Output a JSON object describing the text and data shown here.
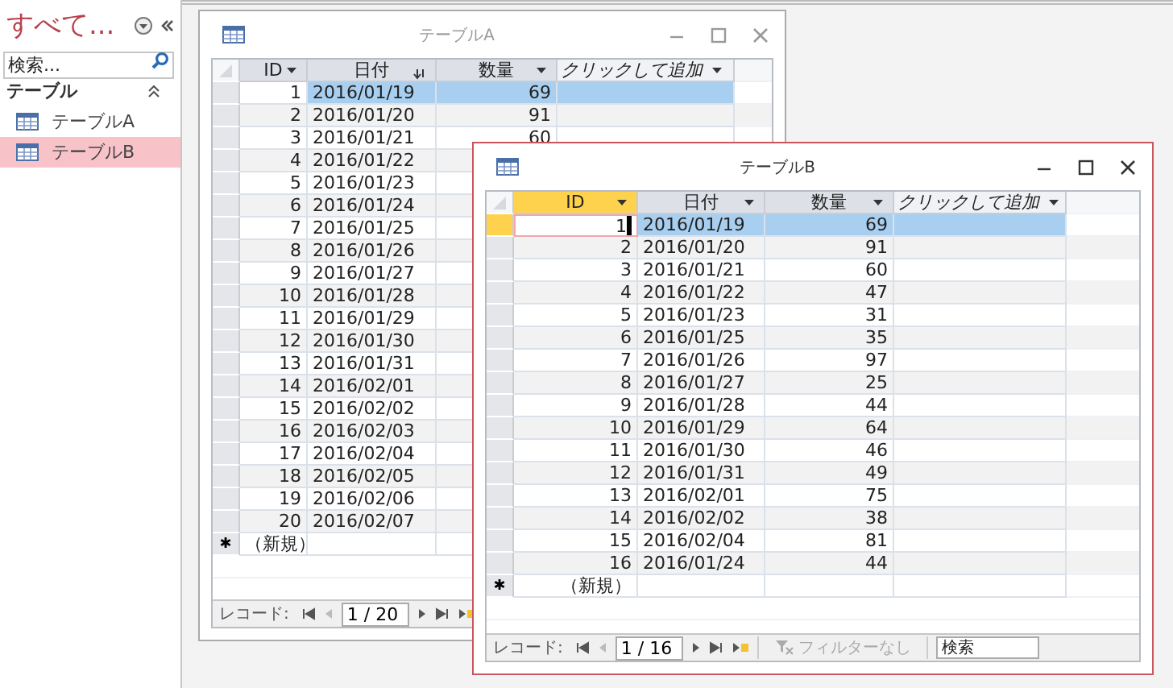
{
  "sidebar": {
    "title": "すべて...",
    "search": {
      "placeholder": "検索..."
    },
    "groups": [
      {
        "label": "テーブル",
        "expanded": true,
        "items": [
          {
            "label": "テーブルA",
            "selected": false
          },
          {
            "label": "テーブルB",
            "selected": true
          }
        ]
      }
    ]
  },
  "windows": [
    {
      "title": "テーブルA",
      "active": false,
      "columns": [
        {
          "label": "ID",
          "kind": "dropdown",
          "selected": false
        },
        {
          "label": "日付",
          "kind": "sort",
          "selected": false
        },
        {
          "label": "数量",
          "kind": "dropdown",
          "selected": false
        },
        {
          "label": "クリックして追加",
          "kind": "add",
          "selected": false
        }
      ],
      "rows": [
        {
          "id": "1",
          "date": "2016/01/19",
          "quantity": "69",
          "selected": true,
          "current": false
        },
        {
          "id": "2",
          "date": "2016/01/20",
          "quantity": "91",
          "selected": false,
          "current": false
        },
        {
          "id": "3",
          "date": "2016/01/21",
          "quantity": "60",
          "selected": false,
          "current": false
        },
        {
          "id": "4",
          "date": "2016/01/22",
          "selected": false,
          "current": false
        },
        {
          "id": "5",
          "date": "2016/01/23",
          "selected": false,
          "current": false
        },
        {
          "id": "6",
          "date": "2016/01/24",
          "selected": false,
          "current": false
        },
        {
          "id": "7",
          "date": "2016/01/25",
          "selected": false,
          "current": false
        },
        {
          "id": "8",
          "date": "2016/01/26",
          "selected": false,
          "current": false
        },
        {
          "id": "9",
          "date": "2016/01/27",
          "selected": false,
          "current": false
        },
        {
          "id": "10",
          "date": "2016/01/28",
          "selected": false,
          "current": false
        },
        {
          "id": "11",
          "date": "2016/01/29",
          "selected": false,
          "current": false
        },
        {
          "id": "12",
          "date": "2016/01/30",
          "selected": false,
          "current": false
        },
        {
          "id": "13",
          "date": "2016/01/31",
          "selected": false,
          "current": false
        },
        {
          "id": "14",
          "date": "2016/02/01",
          "selected": false,
          "current": false
        },
        {
          "id": "15",
          "date": "2016/02/02",
          "selected": false,
          "current": false
        },
        {
          "id": "16",
          "date": "2016/02/03",
          "selected": false,
          "current": false
        },
        {
          "id": "17",
          "date": "2016/02/04",
          "selected": false,
          "current": false
        },
        {
          "id": "18",
          "date": "2016/02/05",
          "selected": false,
          "current": false
        },
        {
          "id": "19",
          "date": "2016/02/06",
          "selected": false,
          "current": false
        },
        {
          "id": "20",
          "date": "2016/02/07",
          "selected": false,
          "current": false
        }
      ],
      "new_row": {
        "marker": "✱",
        "label": "（新規）"
      },
      "nav": {
        "label": "レコード:",
        "position": "1 / 20"
      }
    },
    {
      "title": "テーブルB",
      "active": true,
      "columns": [
        {
          "label": "ID",
          "kind": "dropdown",
          "selected": true
        },
        {
          "label": "日付",
          "kind": "dropdown",
          "selected": false
        },
        {
          "label": "数量",
          "kind": "dropdown",
          "selected": false
        },
        {
          "label": "クリックして追加",
          "kind": "add",
          "selected": false
        }
      ],
      "rows": [
        {
          "id": "1",
          "date": "2016/01/19",
          "quantity": "69",
          "selected": true,
          "current": true
        },
        {
          "id": "2",
          "date": "2016/01/20",
          "quantity": "91",
          "selected": false,
          "current": false
        },
        {
          "id": "3",
          "date": "2016/01/21",
          "quantity": "60",
          "selected": false,
          "current": false
        },
        {
          "id": "4",
          "date": "2016/01/22",
          "quantity": "47",
          "selected": false,
          "current": false
        },
        {
          "id": "5",
          "date": "2016/01/23",
          "quantity": "31",
          "selected": false,
          "current": false
        },
        {
          "id": "6",
          "date": "2016/01/25",
          "quantity": "35",
          "selected": false,
          "current": false
        },
        {
          "id": "7",
          "date": "2016/01/26",
          "quantity": "97",
          "selected": false,
          "current": false
        },
        {
          "id": "8",
          "date": "2016/01/27",
          "quantity": "25",
          "selected": false,
          "current": false
        },
        {
          "id": "9",
          "date": "2016/01/28",
          "quantity": "44",
          "selected": false,
          "current": false
        },
        {
          "id": "10",
          "date": "2016/01/29",
          "quantity": "64",
          "selected": false,
          "current": false
        },
        {
          "id": "11",
          "date": "2016/01/30",
          "quantity": "46",
          "selected": false,
          "current": false
        },
        {
          "id": "12",
          "date": "2016/01/31",
          "quantity": "49",
          "selected": false,
          "current": false
        },
        {
          "id": "13",
          "date": "2016/02/01",
          "quantity": "75",
          "selected": false,
          "current": false
        },
        {
          "id": "14",
          "date": "2016/02/02",
          "quantity": "38",
          "selected": false,
          "current": false
        },
        {
          "id": "15",
          "date": "2016/02/04",
          "quantity": "81",
          "selected": false,
          "current": false
        },
        {
          "id": "16",
          "date": "2016/01/24",
          "quantity": "44",
          "selected": false,
          "current": false
        }
      ],
      "new_row": {
        "marker": "✱",
        "label": "（新規）"
      },
      "nav": {
        "label": "レコード:",
        "position": "1 / 16",
        "filter": {
          "label": "フィルターなし",
          "disabled": true
        },
        "search": {
          "placeholder": "検索"
        }
      }
    }
  ]
}
